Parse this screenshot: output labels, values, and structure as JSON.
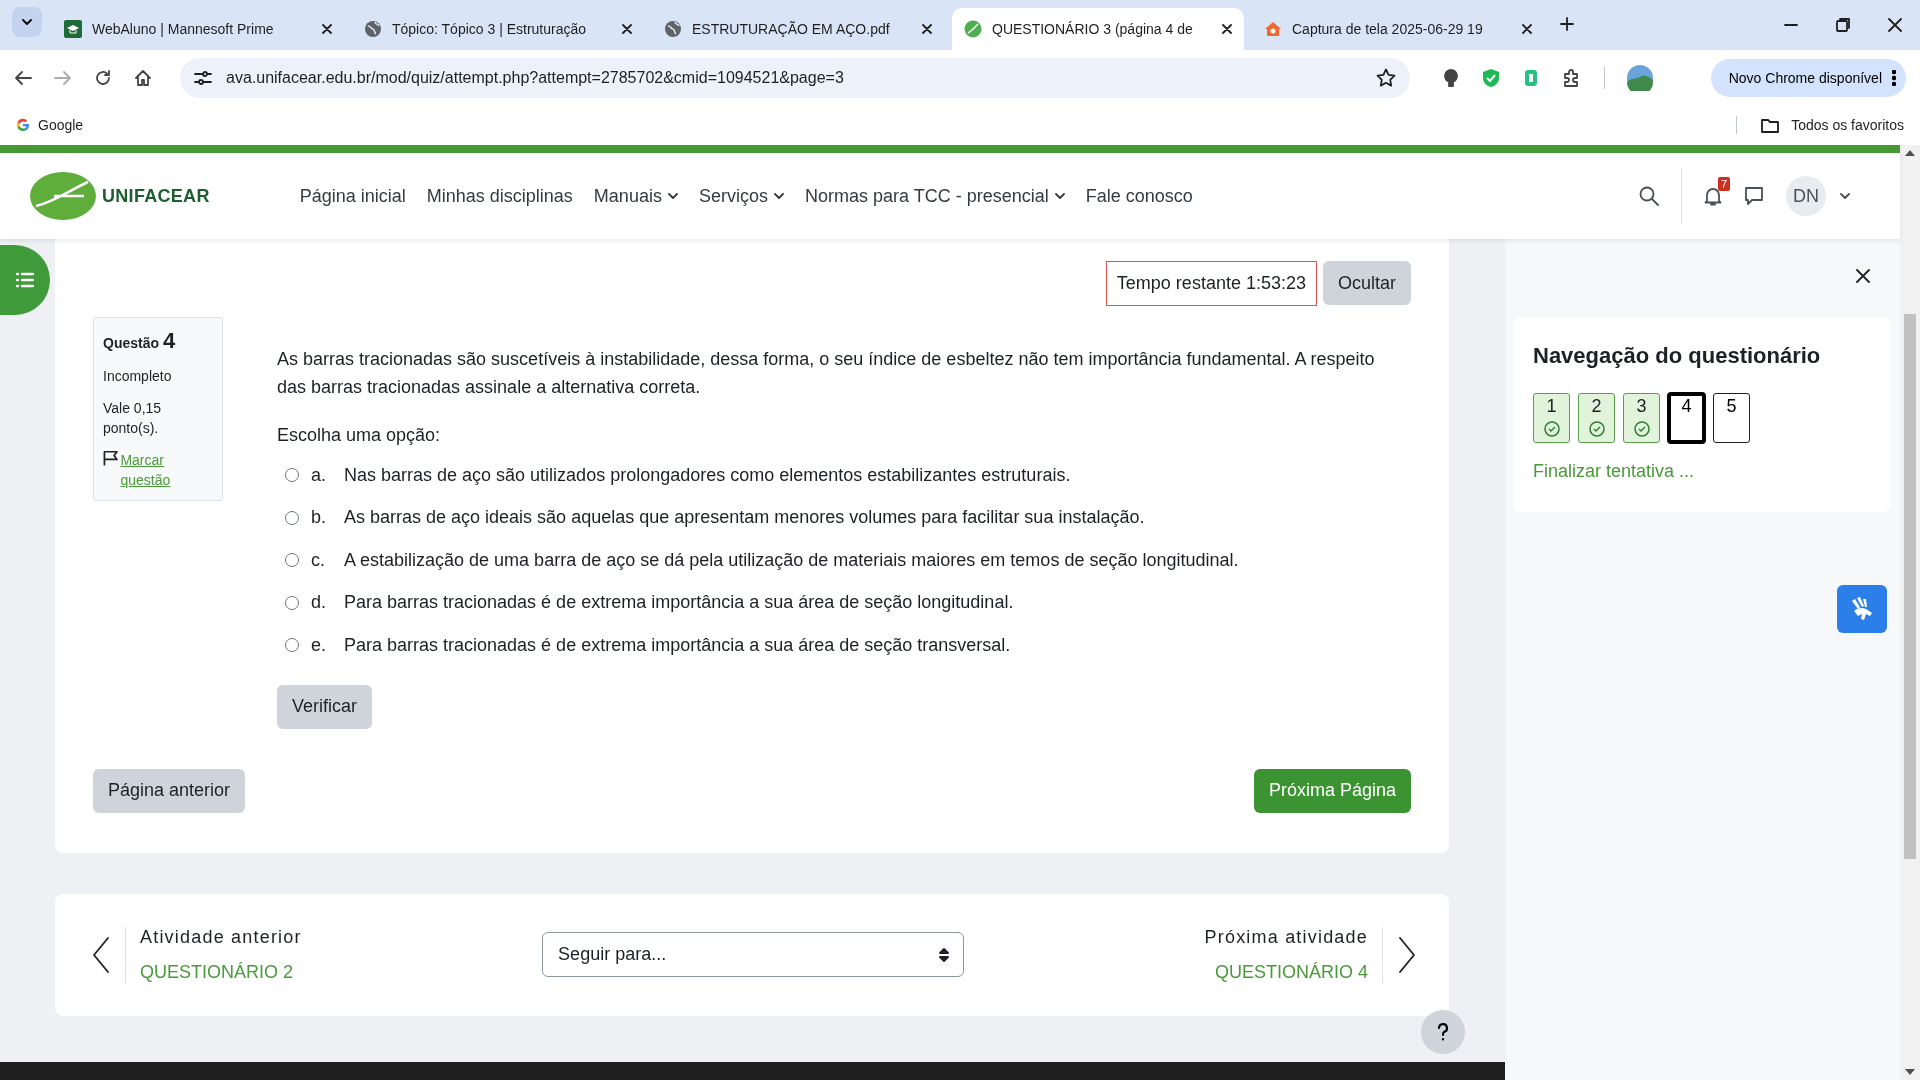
{
  "browser": {
    "tabs": [
      {
        "kind": "app",
        "title": "WebAluno | Mannesoft Prime",
        "selected": false
      },
      {
        "kind": "globe",
        "title": "Tópico: Tópico 3 | Estruturação",
        "selected": false
      },
      {
        "kind": "globe",
        "title": "ESTRUTURAÇÃO EM AÇO.pdf",
        "selected": false
      },
      {
        "kind": "site",
        "title": "QUESTIONÁRIO 3 (página 4 de",
        "selected": true
      },
      {
        "kind": "capture",
        "title": "Captura de tela 2025-06-29 19",
        "selected": false
      }
    ],
    "url": "ava.unifacear.edu.br/mod/quiz/attempt.php?attempt=2785702&cmid=1094521&page=3",
    "update_button": "Novo Chrome disponível",
    "bookmarks": [
      "Google"
    ],
    "all_bookmarks": "Todos os favoritos"
  },
  "site_header": {
    "logo_text": "UNIFACEAR",
    "nav": [
      {
        "label": "Página inicial",
        "dropdown": false
      },
      {
        "label": "Minhas disciplinas",
        "dropdown": false
      },
      {
        "label": "Manuais",
        "dropdown": true
      },
      {
        "label": "Serviços",
        "dropdown": true
      },
      {
        "label": "Normas para TCC - presencial",
        "dropdown": true
      },
      {
        "label": "Fale conosco",
        "dropdown": false
      }
    ],
    "notification_count": "7",
    "avatar": "DN"
  },
  "quiz": {
    "timer": "Tempo restante 1:53:23",
    "hide_button": "Ocultar",
    "info": {
      "label": "Questão",
      "number": "4",
      "status": "Incompleto",
      "points": "Vale 0,15 ponto(s).",
      "flag_link": "Marcar questão"
    },
    "question": "As barras tracionadas são suscetíveis à instabilidade, dessa forma, o seu índice de esbeltez não tem importância fundamental. A respeito das barras tracionadas assinale a alternativa correta.",
    "prompt": "Escolha uma opção:",
    "options": [
      {
        "letter": "a.",
        "text": "Nas barras de aço são utilizados prolongadores como elementos estabilizantes estruturais.",
        "selected": false
      },
      {
        "letter": "b.",
        "text": "As barras de aço ideais são aquelas que apresentam menores volumes para facilitar sua instalação.",
        "selected": false
      },
      {
        "letter": "c.",
        "text": "A estabilização de uma barra de aço se dá pela utilização de materiais maiores em temos de seção longitudinal.",
        "selected": false
      },
      {
        "letter": "d.",
        "text": "Para barras tracionadas é de extrema importância a sua área de seção longitudinal.",
        "selected": false
      },
      {
        "letter": "e.",
        "text": "Para barras tracionadas é de extrema importância a sua área de seção transversal.",
        "selected": false
      }
    ],
    "check_button": "Verificar",
    "prev_button": "Página anterior",
    "next_button": "Próxima Página"
  },
  "activity_nav": {
    "prev_label": "Atividade anterior",
    "prev_link": "QUESTIONÁRIO 2",
    "jump_placeholder": "Seguir para...",
    "next_label": "Próxima atividade",
    "next_link": "QUESTIONÁRIO 4"
  },
  "quiz_navigation": {
    "title": "Navegação do questionário",
    "questions": [
      {
        "number": "1",
        "kind": "answered",
        "selected": false
      },
      {
        "number": "2",
        "kind": "answered",
        "selected": false
      },
      {
        "number": "3",
        "kind": "answered",
        "selected": false
      },
      {
        "number": "4",
        "kind": "unanswered",
        "selected": true
      },
      {
        "number": "5",
        "kind": "unanswered",
        "selected": false
      }
    ],
    "finish_link": "Finalizar tentativa ..."
  }
}
